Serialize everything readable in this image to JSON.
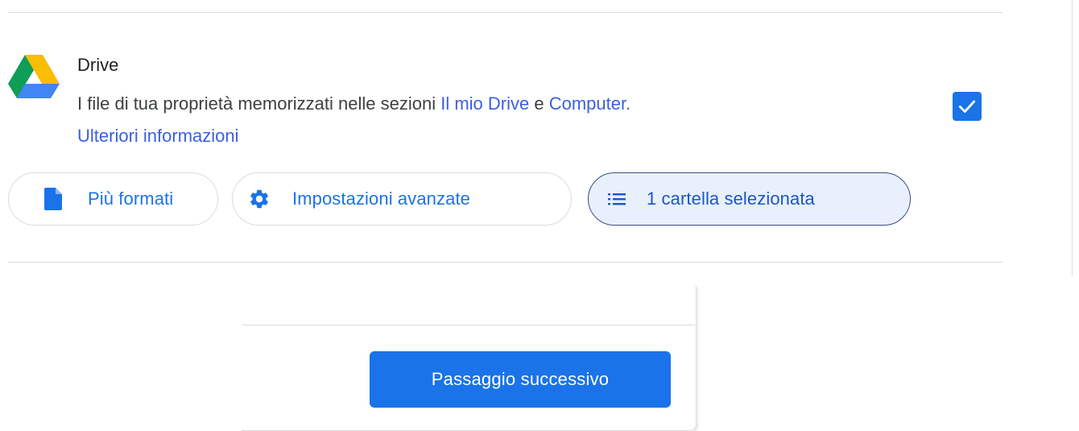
{
  "drive_section": {
    "title": "Drive",
    "description_prefix": "I file di tua proprietà memorizzati nelle sezioni ",
    "link_my_drive": "Il mio Drive",
    "conjunction": " e ",
    "link_computer": "Computer",
    "period": ".",
    "link_more_info": "Ulteriori informazioni",
    "checkbox_checked": true,
    "logo_icon": "google-drive-logo",
    "checkbox_icon": "checkmark-icon"
  },
  "chips": {
    "formats": {
      "label": "Più formati",
      "icon": "file-icon"
    },
    "advanced": {
      "label": "Impostazioni avanzate",
      "icon": "gear-icon"
    },
    "folders": {
      "label": "1 cartella selezionata",
      "icon": "list-icon"
    }
  },
  "footer": {
    "next_button_label": "Passaggio successivo"
  },
  "colors": {
    "accent": "#1a73e8",
    "selected_chip_bg": "#e8f0fe",
    "divider": "#dadce0",
    "text": "#3c4043"
  }
}
